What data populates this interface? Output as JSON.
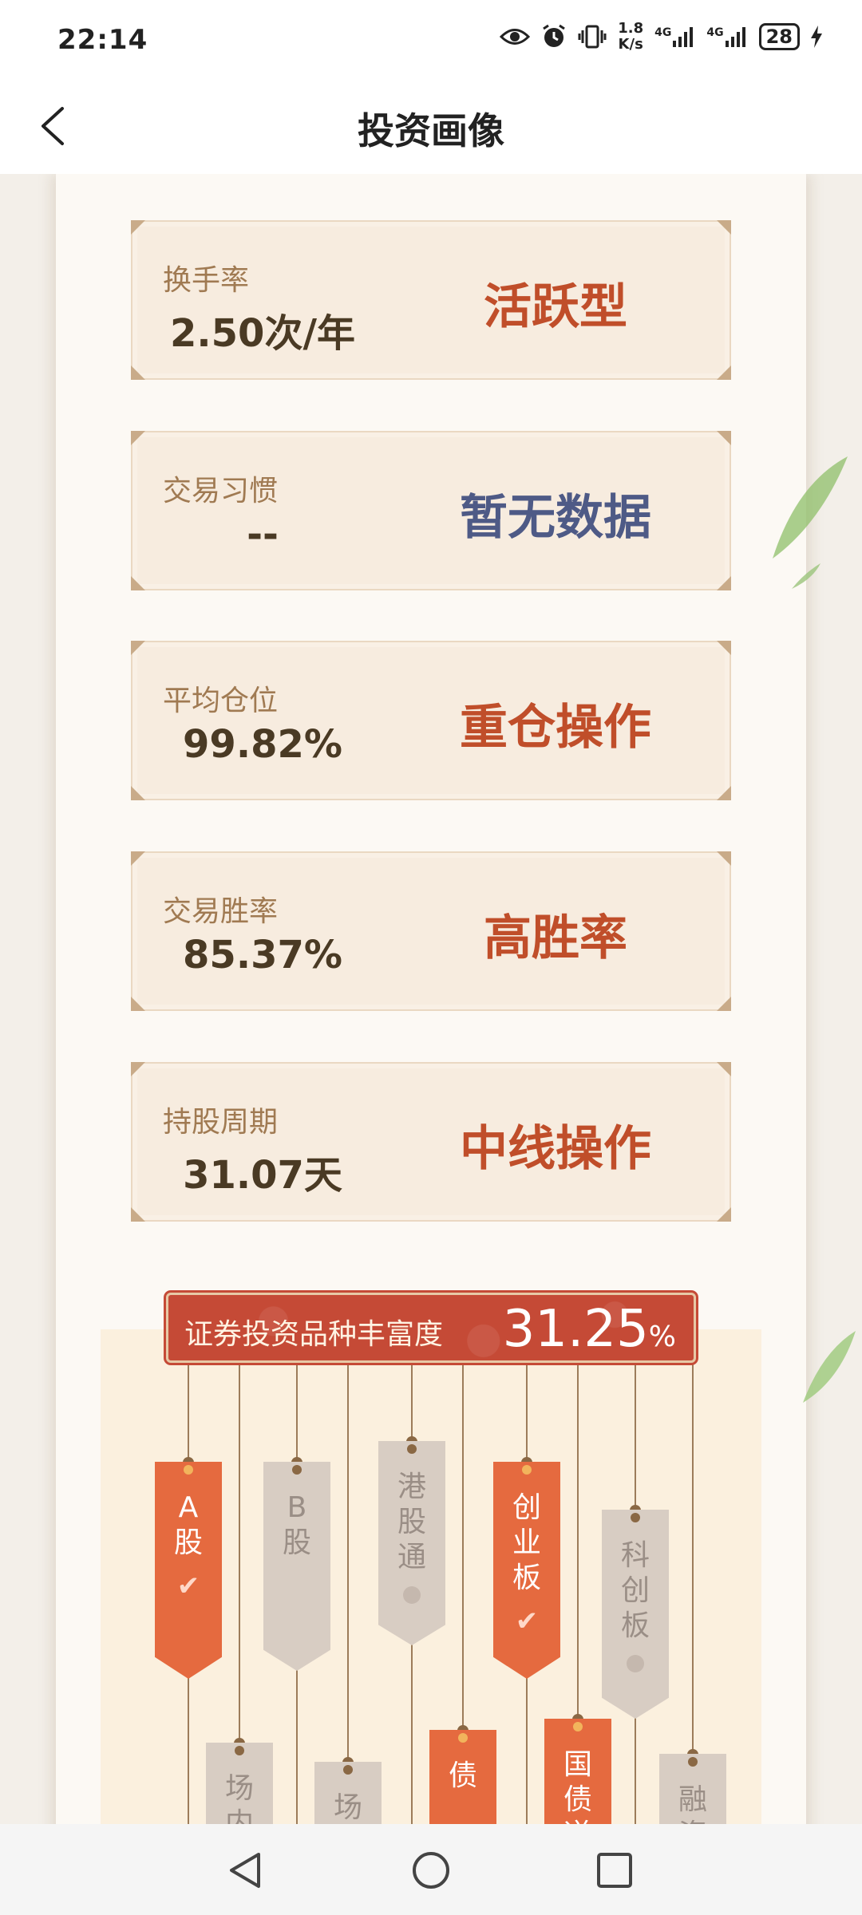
{
  "status_bar": {
    "time": "22:14",
    "net_speed_value": "1.8",
    "net_speed_unit": "K/s",
    "signal1_label": "4G",
    "signal2_label": "4G",
    "battery": "28",
    "icons": [
      "eye-icon",
      "alarm-icon",
      "vibrate-icon",
      "signal-icon",
      "signal-icon",
      "battery-icon",
      "charging-icon"
    ]
  },
  "header": {
    "title": "投资画像",
    "back_icon": "chevron-left-icon"
  },
  "metrics": [
    {
      "label": "换手率",
      "value": "2.50次/年",
      "tag": "活跃型",
      "tag_color": "#c04e2a"
    },
    {
      "label": "交易习惯",
      "value": "--",
      "tag": "暂无数据",
      "tag_color": "#4e5a86"
    },
    {
      "label": "平均仓位",
      "value": "99.82%",
      "tag": "重仓操作",
      "tag_color": "#c04e2a"
    },
    {
      "label": "交易胜率",
      "value": "85.37%",
      "tag": "高胜率",
      "tag_color": "#c04e2a"
    },
    {
      "label": "持股周期",
      "value": "31.07天",
      "tag": "中线操作",
      "tag_color": "#c04e2a"
    }
  ],
  "variety": {
    "label": "证券投资品种丰富度",
    "value": "31.25",
    "unit": "%",
    "products": [
      {
        "name": "A股",
        "lines": [
          "A",
          "股"
        ],
        "active": true
      },
      {
        "name": "场内",
        "lines": [
          "场",
          "内"
        ],
        "active": false
      },
      {
        "name": "B股",
        "lines": [
          "B",
          "股"
        ],
        "active": false
      },
      {
        "name": "场外",
        "lines": [
          "场",
          "外"
        ],
        "active": false
      },
      {
        "name": "港股通",
        "lines": [
          "港",
          "股",
          "通"
        ],
        "active": false
      },
      {
        "name": "债",
        "lines": [
          "债"
        ],
        "active": true
      },
      {
        "name": "创业板",
        "lines": [
          "创",
          "业",
          "板"
        ],
        "active": true
      },
      {
        "name": "国债逆",
        "lines": [
          "国",
          "债",
          "逆"
        ],
        "active": true
      },
      {
        "name": "科创板",
        "lines": [
          "科",
          "创",
          "板"
        ],
        "active": false
      },
      {
        "name": "融资",
        "lines": [
          "融",
          "资"
        ],
        "active": false
      }
    ]
  },
  "nav_bar": {
    "back": "back-triangle-icon",
    "home": "home-circle-icon",
    "recents": "recents-square-icon"
  }
}
